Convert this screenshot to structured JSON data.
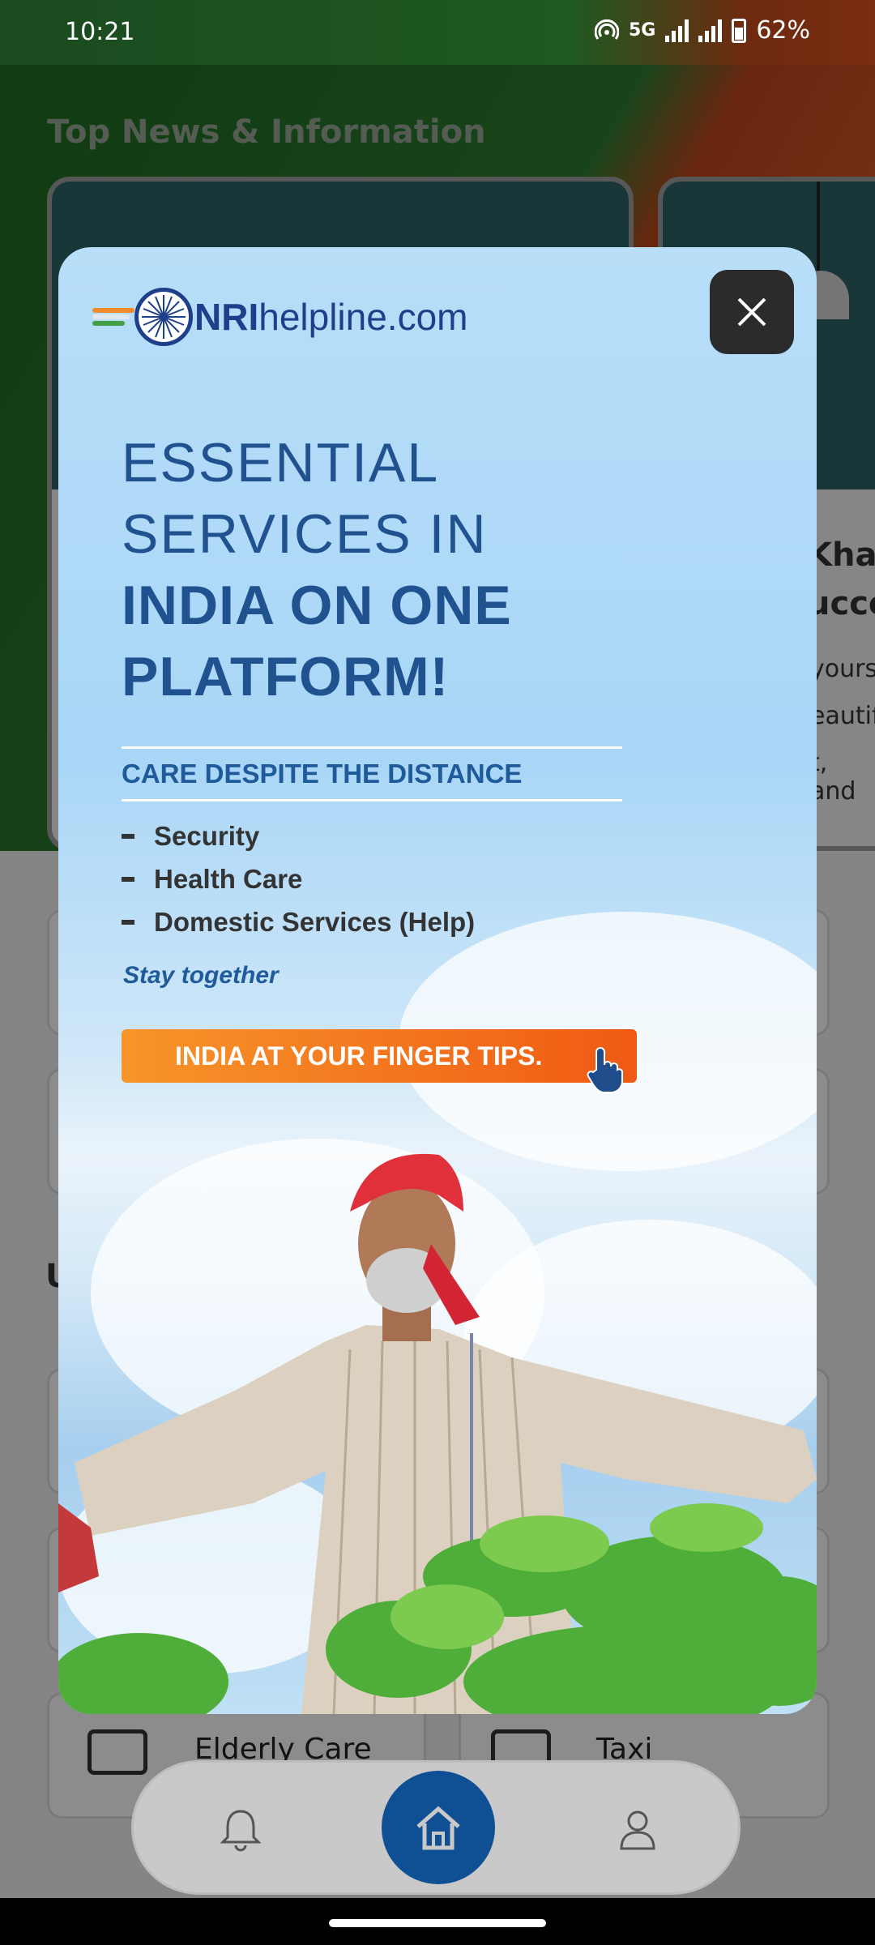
{
  "status_bar": {
    "time": "10:21",
    "network": "5G",
    "battery": "62%"
  },
  "background": {
    "section_title": "Top News & Information",
    "news_card_peek": {
      "line1": "Khale",
      "line2": "ucce",
      "line3": "yours",
      "line4": "eautif",
      "line5": "t, and"
    },
    "section_initial": "U",
    "services": [
      {
        "label": "Elderly Care",
        "icon": "id-card-icon"
      },
      {
        "label": "Taxi",
        "icon": "id-card-icon"
      }
    ]
  },
  "ad": {
    "logo": {
      "bold": "NRI",
      "rest": "helpline.com"
    },
    "headline_light": [
      "ESSENTIAL",
      "SERVICES IN"
    ],
    "headline_bold": [
      "INDIA ON ONE",
      "PLATFORM!"
    ],
    "tagline": "CARE DESPITE THE DISTANCE",
    "services": [
      "Security",
      "Health Care",
      "Domestic Services (Help)"
    ],
    "stay": "Stay together",
    "cta": "INDIA AT YOUR FINGER TIPS.",
    "close_icon": "close-icon"
  },
  "bottom_nav": {
    "items": [
      {
        "icon": "bell-icon"
      },
      {
        "icon": "home-icon"
      },
      {
        "icon": "profile-icon"
      }
    ]
  },
  "colors": {
    "ad_blue": "#20528f",
    "cta_orange": "#f26c1c",
    "nav_home": "#0f4f93"
  }
}
